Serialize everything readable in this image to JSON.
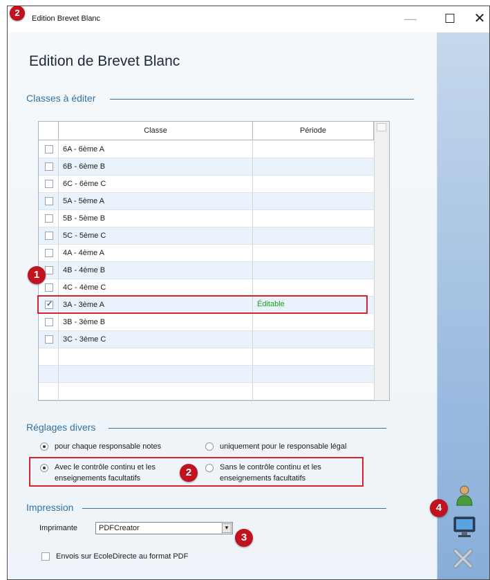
{
  "window": {
    "title": "Edition Brevet Blanc",
    "controls": {
      "minimize": "—",
      "maximize": "☐",
      "close": "✕"
    }
  },
  "page": {
    "heading": "Edition de Brevet Blanc"
  },
  "classes": {
    "section_title": "Classes à éditer",
    "columns": [
      "Classe",
      "Période"
    ],
    "rows": [
      {
        "classe": "6A - 6ème A",
        "periode": "",
        "checked": false
      },
      {
        "classe": "6B - 6ème B",
        "periode": "",
        "checked": false
      },
      {
        "classe": "6C - 6ème C",
        "periode": "",
        "checked": false
      },
      {
        "classe": "5A - 5ème A",
        "periode": "",
        "checked": false
      },
      {
        "classe": "5B - 5ème B",
        "periode": "",
        "checked": false
      },
      {
        "classe": "5C - 5ème C",
        "periode": "",
        "checked": false
      },
      {
        "classe": "4A - 4ème A",
        "periode": "",
        "checked": false
      },
      {
        "classe": "4B - 4ème B",
        "periode": "",
        "checked": false
      },
      {
        "classe": "4C - 4ème C",
        "periode": "",
        "checked": false
      },
      {
        "classe": "3A - 3ème A",
        "periode": "Éditable",
        "checked": true
      },
      {
        "classe": "3B - 3ème B",
        "periode": "",
        "checked": false
      },
      {
        "classe": "3C - 3ème C",
        "periode": "",
        "checked": false
      }
    ]
  },
  "settings": {
    "section_title": "Réglages divers",
    "opt_notes": "pour chaque responsable notes",
    "opt_legal": "uniquement pour le responsable légal",
    "opt_with_cc_line1": "Avec le contrôle continu et les",
    "opt_with_cc_line2": "enseignements facultatifs",
    "opt_without_cc_line1": "Sans le contrôle continu et les",
    "opt_without_cc_line2": "enseignements facultatifs",
    "selected_responsable": "notes",
    "selected_cc": "with"
  },
  "printing": {
    "section_title": "Impression",
    "printer_label": "Imprimante",
    "printer_value": "PDFCreator",
    "send_pdf_label": "Envois sur EcoleDirecte au format PDF",
    "send_pdf_checked": false
  },
  "annotations": {
    "badge_1": "1",
    "badge_2": "2",
    "badge_3": "3",
    "badge_4": "4"
  },
  "side_icons": [
    "user-icon",
    "monitor-icon",
    "close-x-icon"
  ],
  "colors": {
    "accent": "#2f73a8",
    "highlight_red": "#d6232f",
    "editable_green": "#1aa11a"
  }
}
